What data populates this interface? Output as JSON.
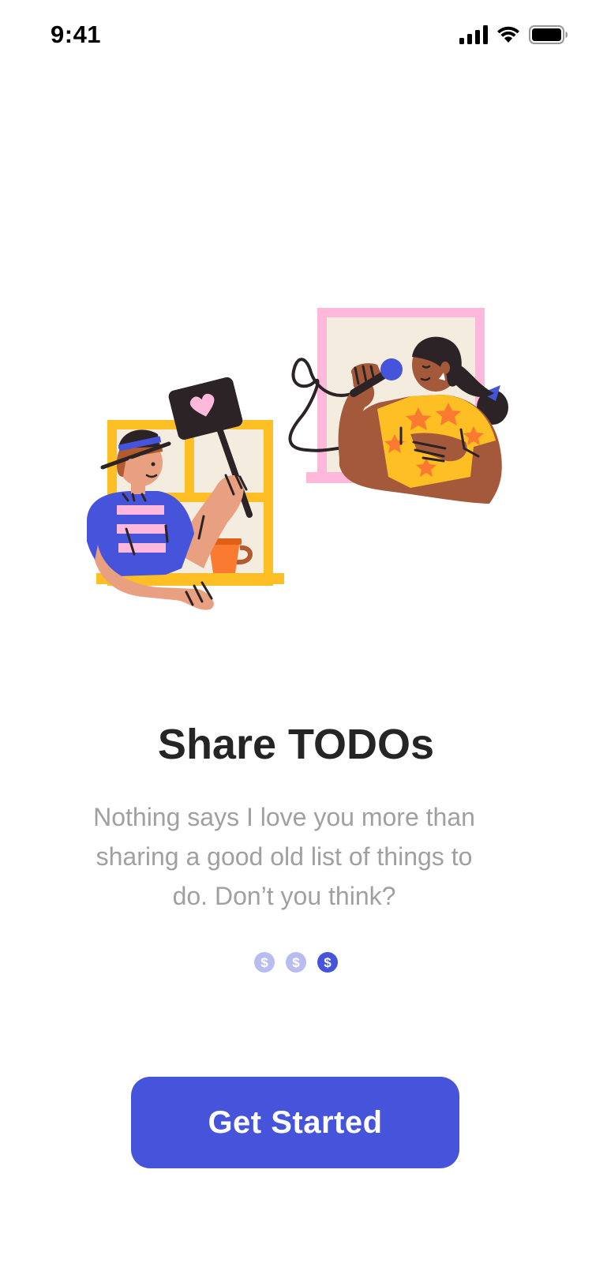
{
  "status_bar": {
    "time": "9:41",
    "icons": [
      "signal-icon",
      "wifi-icon",
      "battery-icon"
    ]
  },
  "illustration": {
    "colors": {
      "yellow_window": "#fdbf24",
      "pink_window": "#fdb8dc",
      "window_pane": "#f5ece0",
      "shirt_blue": "#4654dc",
      "stripe_pink": "#fdb8dc",
      "skin_light": "#e8a080",
      "skin_dark": "#a4593b",
      "hair_dark": "#2b2326",
      "shirt_yellow": "#fdbf24",
      "star_orange": "#fa7a32",
      "mug_orange": "#fa7a32",
      "sign_dark": "#2b2326",
      "heart_pink": "#fdb8dc"
    }
  },
  "onboarding": {
    "title": "Share TODOs",
    "description_lines": [
      "Nothing says I love you more than",
      "sharing a good old list of things to",
      "do. Don’t you think?"
    ]
  },
  "pager": {
    "dots": [
      {
        "glyph": "$",
        "active": false
      },
      {
        "glyph": "$",
        "active": false
      },
      {
        "glyph": "$",
        "active": true
      }
    ],
    "colors": {
      "inactive": "#b8bcee",
      "active": "#4654dc"
    }
  },
  "cta": {
    "label": "Get Started",
    "color": "#4654dc"
  }
}
